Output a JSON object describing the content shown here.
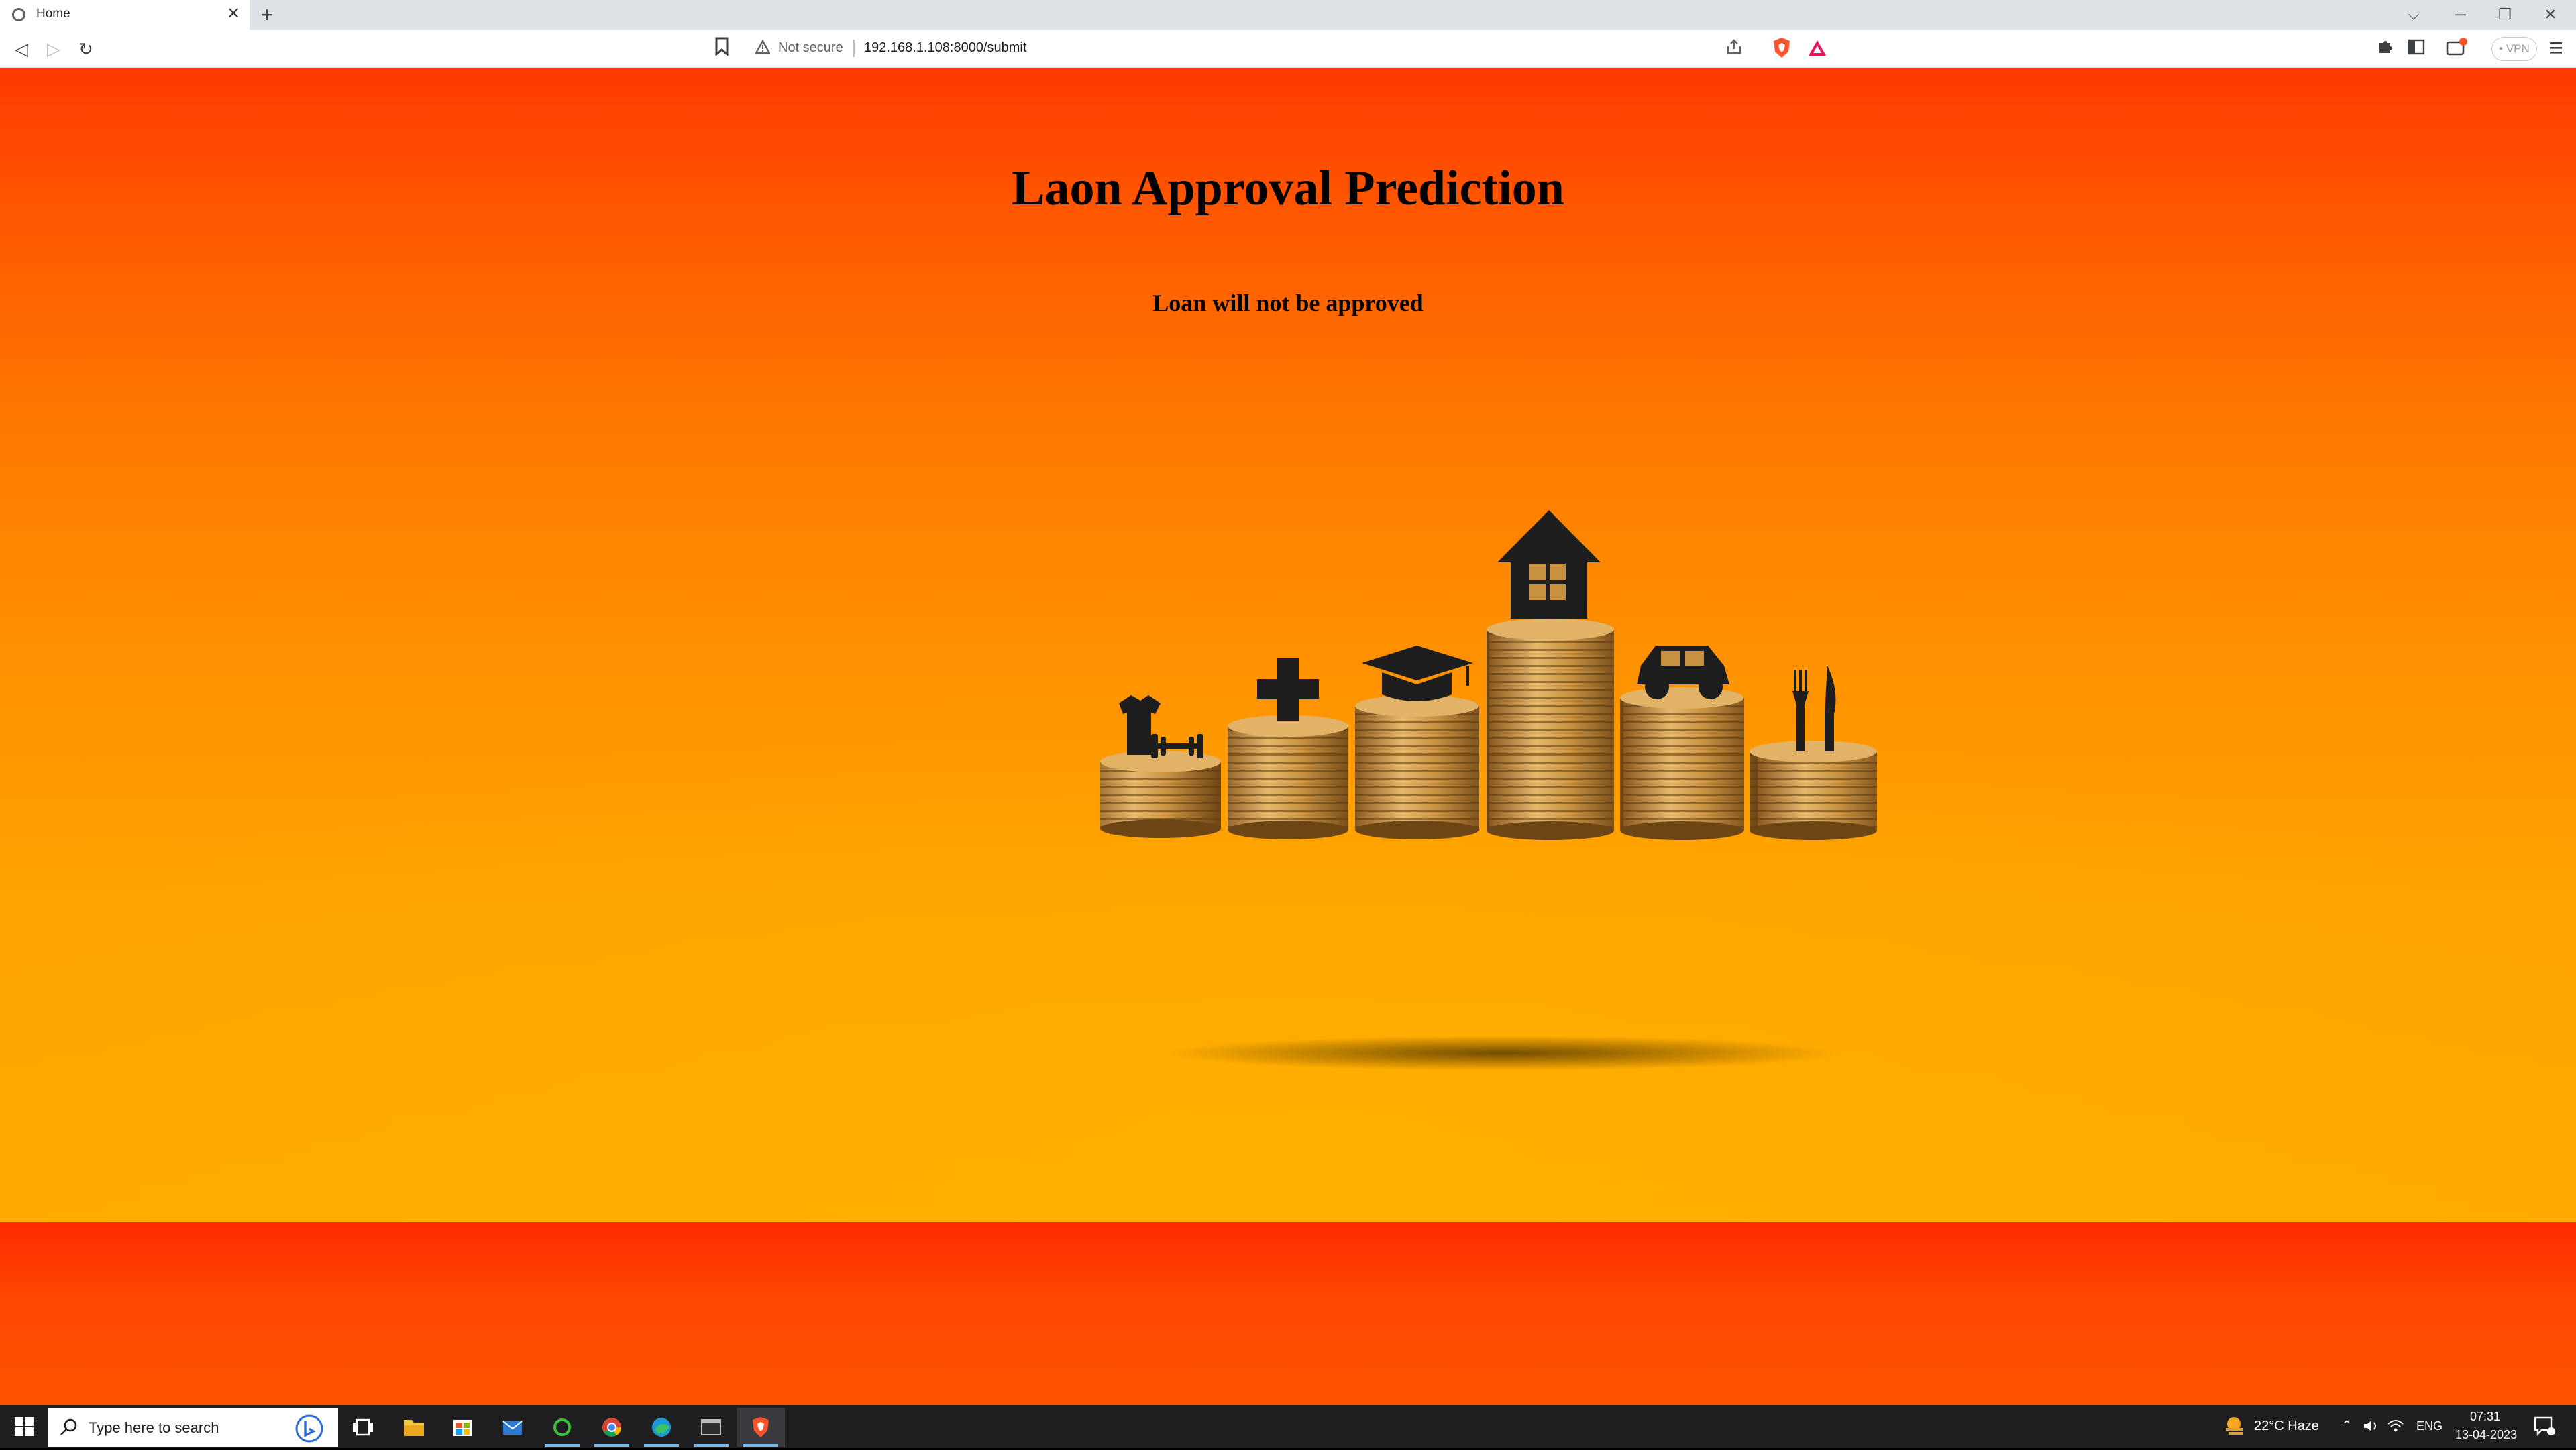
{
  "browser": {
    "tab": {
      "title": "Home",
      "close_glyph": "✕"
    },
    "new_tab_glyph": "+",
    "window_controls": {
      "dropdown": "⌵",
      "minimize": "─",
      "restore": "❐",
      "close": "✕"
    },
    "toolbar": {
      "back_glyph": "◁",
      "forward_glyph": "▷",
      "reload_glyph": "↻",
      "bookmark_glyph": "🔖",
      "security_label": "Not secure",
      "url": "192.168.1.108:8000/submit",
      "vpn_label": "• VPN"
    }
  },
  "page": {
    "title": "Laon Approval Prediction",
    "result": "Loan will not be approved",
    "illustration": {
      "icons": [
        "clothing-fitness-icon",
        "medical-cross-icon",
        "graduation-cap-icon",
        "house-icon",
        "car-icon",
        "fork-knife-icon"
      ],
      "coin_color": "#c8913f",
      "icon_color": "#1e1e1e"
    },
    "colors": {
      "top": "#ff3a00",
      "middle": "#ff8a00",
      "bottom": "#ffaa00",
      "footer_band": "#ff3a00"
    }
  },
  "taskbar": {
    "search_placeholder": "Type here to search",
    "apps": [
      "task-view",
      "file-explorer",
      "microsoft-store",
      "mail",
      "app-green-ring",
      "chrome",
      "edge",
      "terminal",
      "brave"
    ],
    "weather": "22°C  Haze",
    "language": "ENG",
    "time": "07:31",
    "date": "13-04-2023"
  }
}
